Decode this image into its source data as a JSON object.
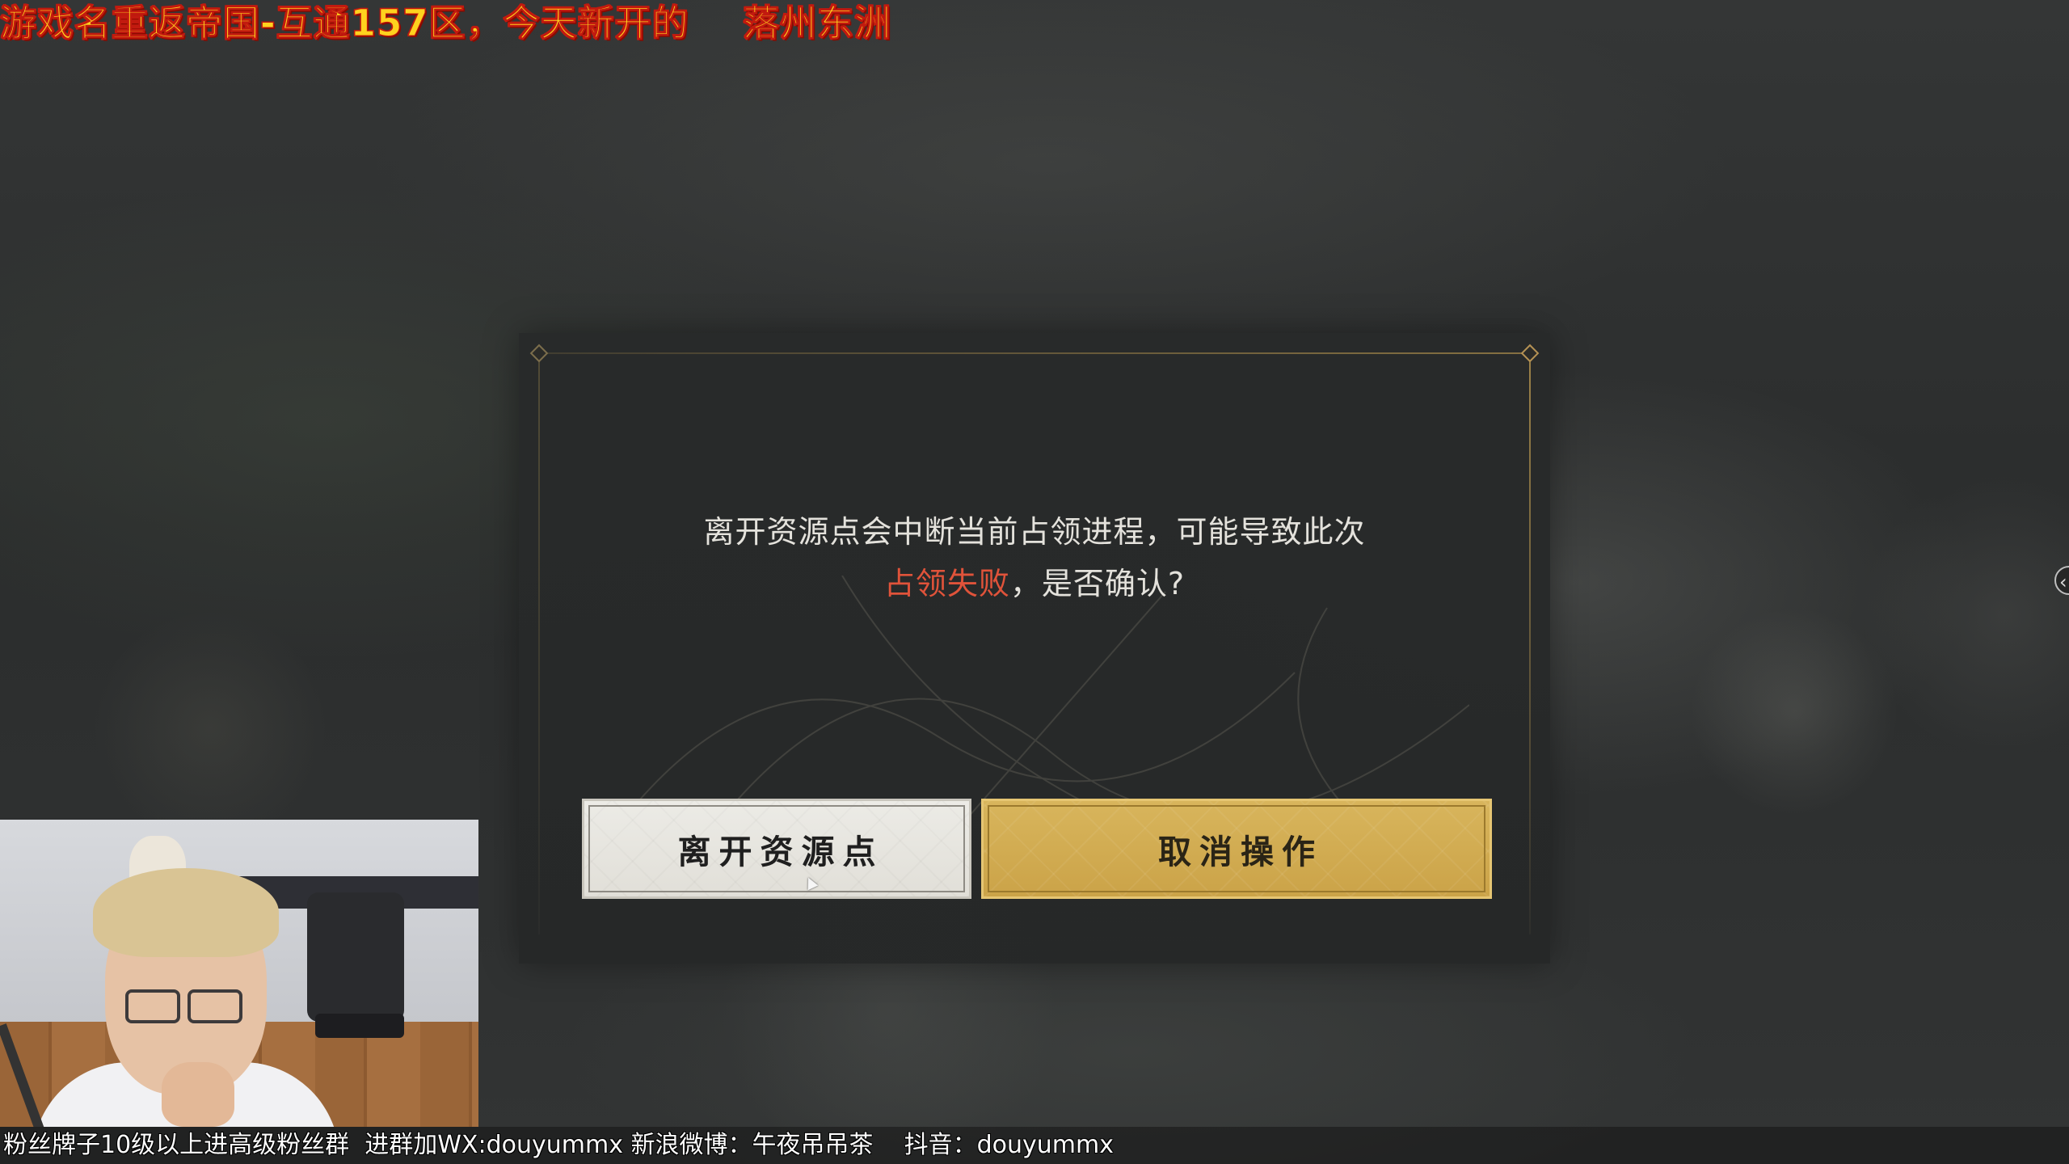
{
  "stream_overlay": {
    "title": "游戏名重返帝国-互通157区，今天新开的    落州东洲",
    "ticker": "粉丝牌子10级以上进高级粉丝群  进群加WX:douyummx 新浪微博：午夜吊吊茶    抖音：douyummx"
  },
  "dialog": {
    "message_line1": "离开资源点会中断当前占领进程，可能导致此次",
    "message_warning": "占领失败",
    "message_line2_rest": "，是否确认?",
    "leave_button_label": "离开资源点",
    "cancel_button_label": "取消操作"
  },
  "icons": {
    "side_arrow": "chevron-left-icon",
    "frame_corner": "diamond-ornament-icon",
    "cursor": "mouse-cursor-icon"
  },
  "colors": {
    "title_fill": "#ffd21e",
    "title_stroke": "#c21a0f",
    "warning_text": "#e0533a",
    "cancel_button": "#d2ad52",
    "leave_button": "#e6e4de"
  }
}
